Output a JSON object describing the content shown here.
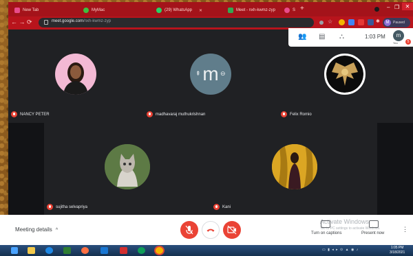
{
  "browser": {
    "tabs": [
      {
        "label": "New Tab",
        "color": "#e84c8a"
      },
      {
        "label": "MyMac",
        "color": "#3fbf3f"
      },
      {
        "label": "(29) WhatsApp",
        "color": "#25d366"
      },
      {
        "label": "Meet - nxh-kwmz-zyp",
        "color": "#34a853"
      },
      {
        "label": "S",
        "color": "#e84c8a"
      }
    ],
    "new_tab_glyph": "+",
    "url_host": "meet.google.com",
    "url_path": "/nxh-kwmz-zyp",
    "profile_initial": "M",
    "profile_label": "Paused",
    "window_controls": [
      "–",
      "❐",
      "✕"
    ]
  },
  "meet_toolbar": {
    "icons": [
      "people-icon",
      "chat-icon",
      "activities-icon"
    ],
    "time": "1:03 PM",
    "self_initial": "m",
    "self_label": "You",
    "badge": "5"
  },
  "participants": [
    {
      "name": "NANCY PETER",
      "mic": "muted"
    },
    {
      "name": "madhavaraj muthukrishnan",
      "mic": "muted",
      "initial": "m"
    },
    {
      "name": "Felix Romio",
      "mic": "muted"
    },
    {
      "name": "sujitha selvapriya",
      "mic": "muted"
    },
    {
      "name": "Kani",
      "mic": "muted"
    }
  ],
  "bottom_bar": {
    "meeting_details": "Meeting details",
    "chevron": "^",
    "captions_label": "Turn on captions",
    "present_label": "Present now",
    "watermark_title": "Activate Windows",
    "watermark_sub": "Go to PC settings to activate Windows."
  },
  "taskbar": {
    "clock_time": "1:05 PM",
    "clock_date": "3/18/2021"
  },
  "colors": {
    "meet_bg": "#202124",
    "danger": "#ea4335",
    "tab_strip": "#a4131a"
  }
}
